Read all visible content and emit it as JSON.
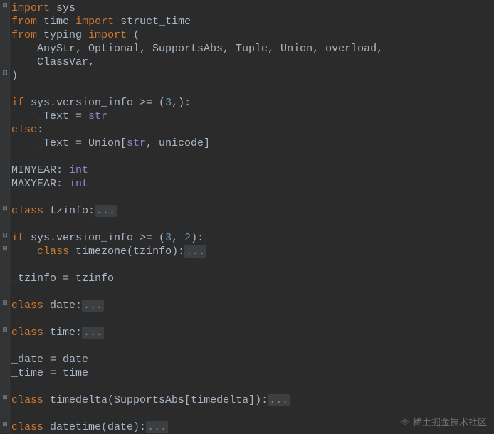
{
  "code": {
    "kw_import": "import",
    "kw_from": "from",
    "kw_if": "if",
    "kw_else": "else",
    "kw_class": "class",
    "mod_sys": "sys",
    "mod_time": "time",
    "mod_typing": "typing",
    "name_struct_time": "struct_time",
    "paren_open": "(",
    "paren_close": ")",
    "typing_list": "    AnyStr, Optional, SupportsAbs, Tuple, Union, overload,",
    "typing_list2": "    ClassVar,",
    "cond1_pre": "sys.version_info >= (",
    "cond1_num": "3",
    "cond1_post": ",):",
    "assign_text_str_pre": "    _Text = ",
    "str_builtin": "str",
    "else_colon": ":",
    "assign_text_union_pre": "    _Text = Union[",
    "assign_text_union_post": ", unicode]",
    "minyear": "MINYEAR: ",
    "maxyear": "MAXYEAR: ",
    "int_builtin": "int",
    "class_tzinfo": "tzinfo:",
    "cond2_pre": "sys.version_info >= (",
    "cond2_n1": "3",
    "cond2_mid": ", ",
    "cond2_n2": "2",
    "cond2_post": "):",
    "class_timezone": "timezone(tzinfo):",
    "assign_tzinfo": "_tzinfo = tzinfo",
    "class_date": "date:",
    "class_time": "time:",
    "assign_date": "_date = date",
    "assign_time": "_time = time",
    "class_timedelta": "timedelta(SupportsAbs[timedelta]):",
    "class_datetime": "datetime(date):",
    "fold_ellipsis": "..."
  },
  "gutter": {
    "minus": "⊟",
    "plus": "⊞"
  },
  "watermark": "稀土掘金技术社区"
}
